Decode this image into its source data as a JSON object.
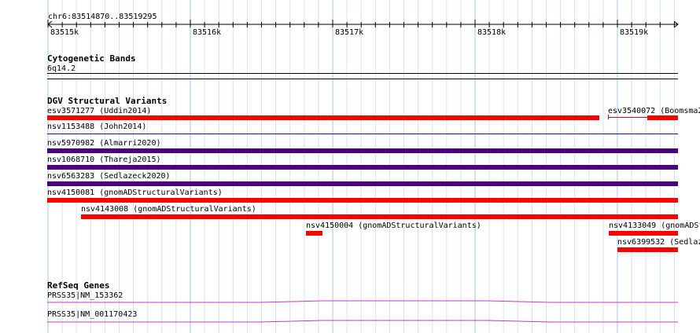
{
  "ruler": {
    "region": "chr6:83514870..83519295",
    "ticks": [
      "83515k",
      "83516k",
      "83517k",
      "83518k",
      "83519k"
    ]
  },
  "tracks": {
    "cytobands": {
      "title": "Cytogenetic Bands",
      "band_label": "6q14.2"
    },
    "dgv": {
      "title": "DGV Structural Variants",
      "features": [
        {
          "label": "esv3571277 (Uddin2014)",
          "color": "#ff0000"
        },
        {
          "label": "esv3540072 (Boomsma2",
          "color": "#ff0000"
        },
        {
          "label": "nsv1153488 (John2014)",
          "color": "#3d0099"
        },
        {
          "label": "nsv5970982 (Almarri2020)",
          "color": "#4b0082"
        },
        {
          "label": "nsv1068710 (Thareja2015)",
          "color": "#4b0082"
        },
        {
          "label": "nsv6563283 (Sedlazeck2020)",
          "color": "#4b0082"
        },
        {
          "label": "nsv4150081 (gnomADStructuralVariants)",
          "color": "#ff0000"
        },
        {
          "label": "nsv4143008 (gnomADStructuralVariants)",
          "color": "#ff0000"
        },
        {
          "label": "nsv4150004 (gnomADStructuralVariants)",
          "color": "#ff0000"
        },
        {
          "label": "nsv4133049 (gnomADSt",
          "color": "#ff0000"
        },
        {
          "label": "nsv6399532 (Sedlaz",
          "color": "#ff0000"
        }
      ]
    },
    "refseq": {
      "title": "RefSeq Genes",
      "genes": [
        {
          "label": "PRSS35|NM_153362",
          "color": "#cc33cc"
        },
        {
          "label": "PRSS35|NM_001170423",
          "color": "#cc33cc"
        }
      ]
    }
  }
}
